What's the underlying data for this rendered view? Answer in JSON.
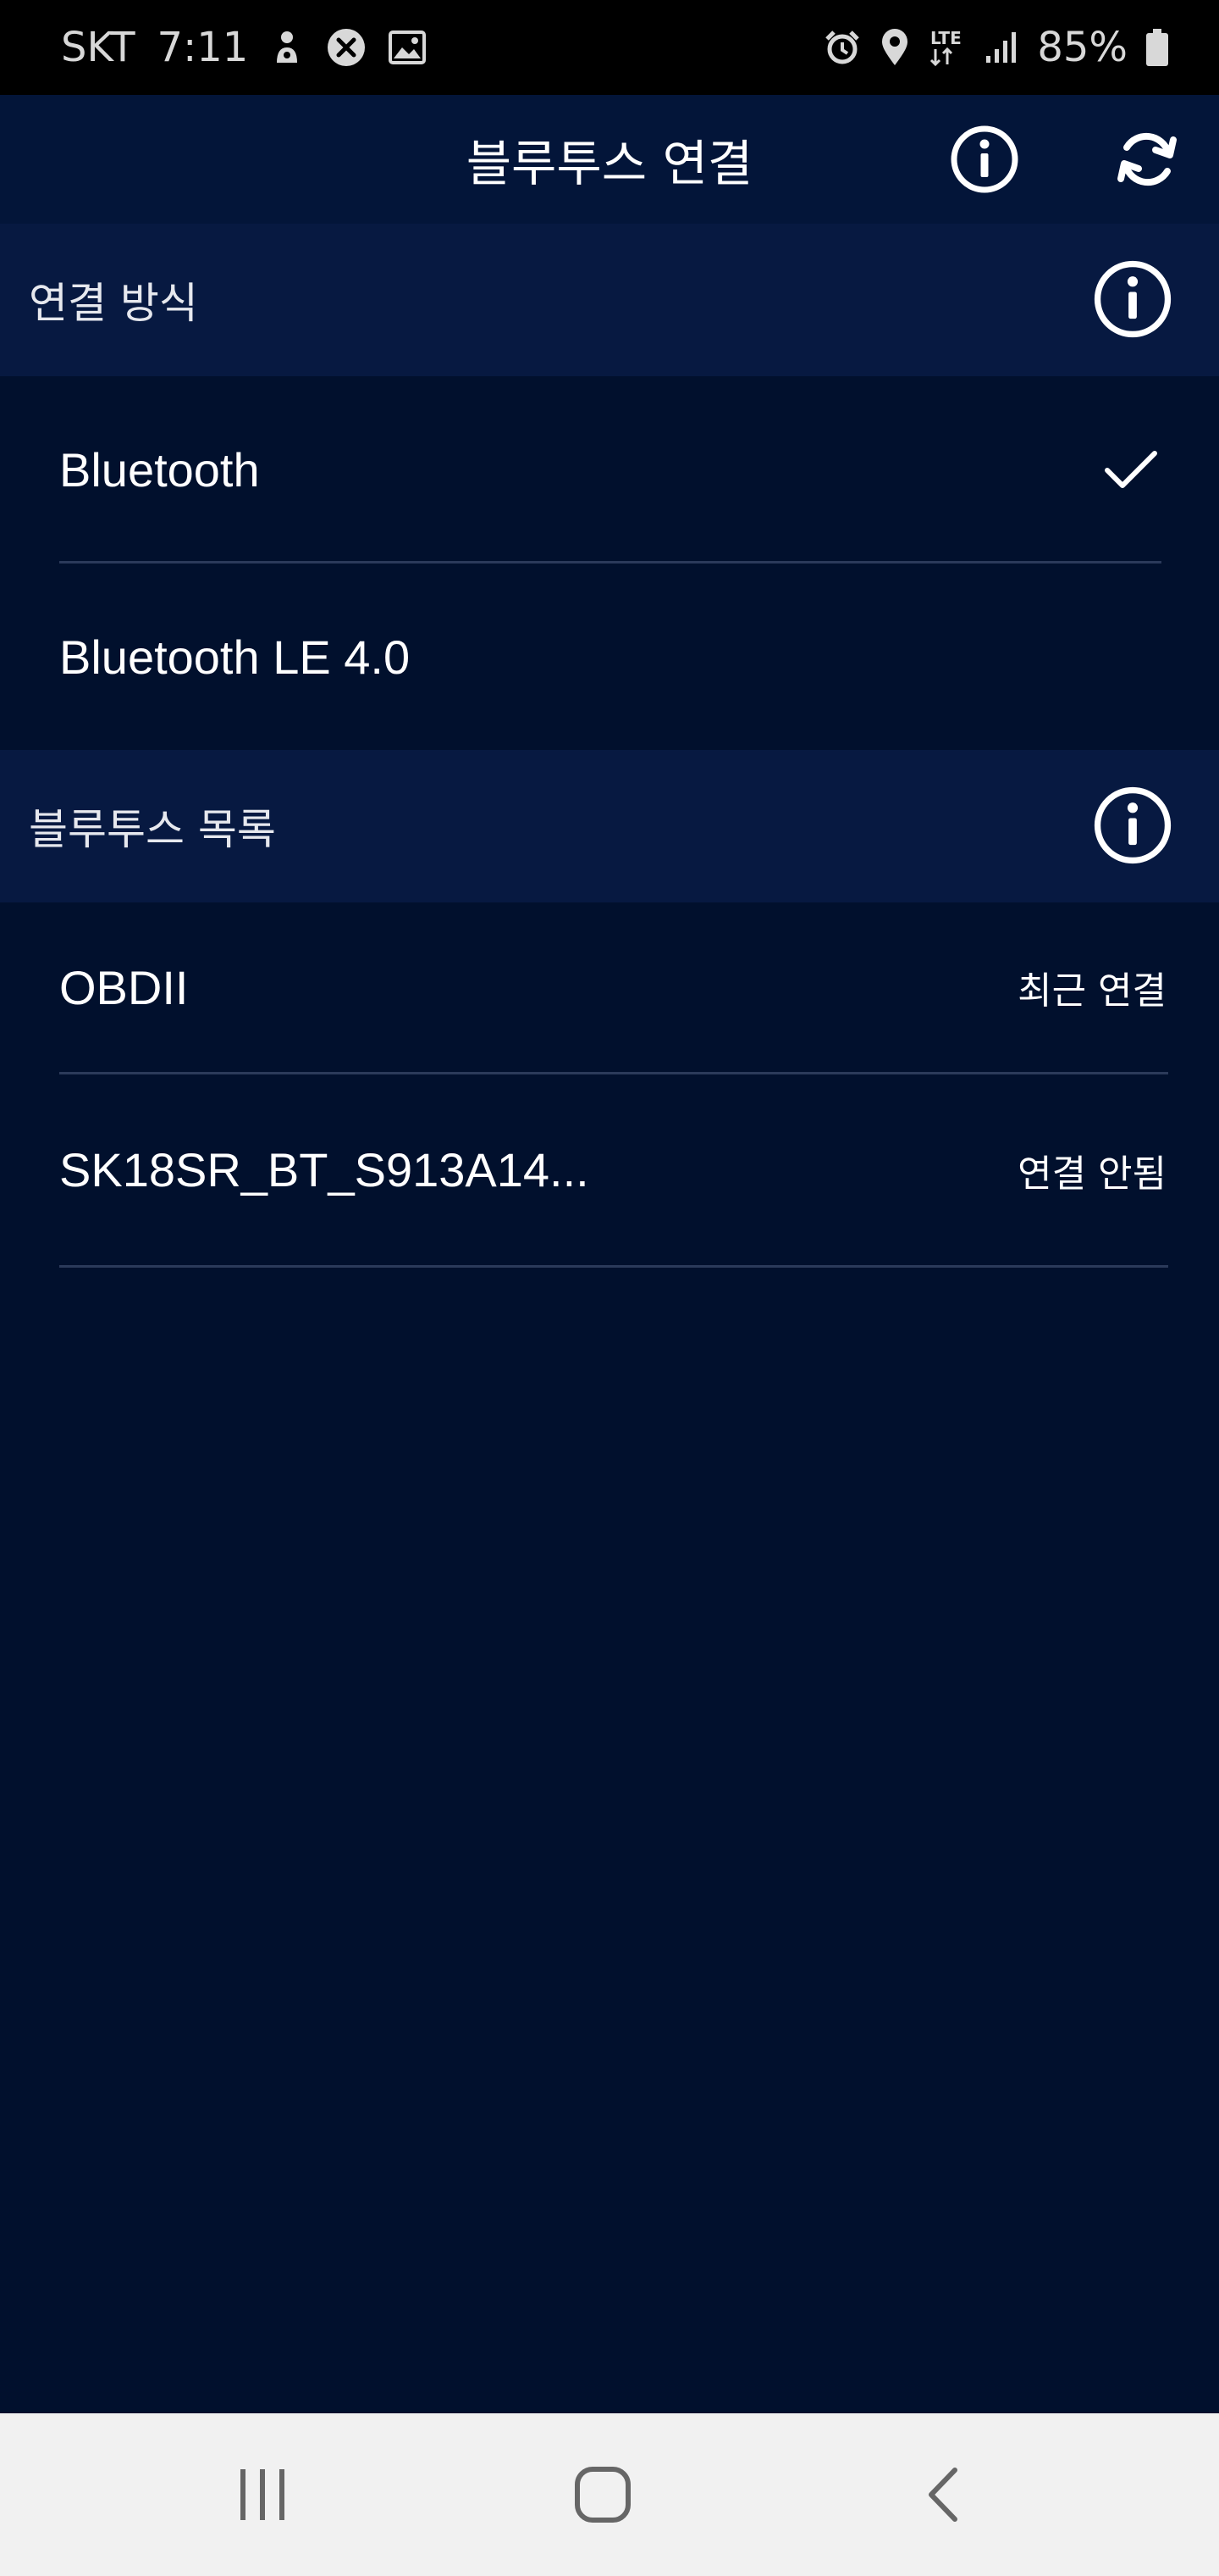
{
  "status_bar": {
    "carrier": "SKT",
    "time": "7:11",
    "network": "LTE",
    "battery": "85%",
    "left_icons": [
      "alarm-clock-notification-icon",
      "blocked-icon",
      "image-icon"
    ],
    "right_icons": [
      "alarm-icon",
      "location-icon",
      "lte-icon",
      "signal-icon",
      "battery-icon"
    ]
  },
  "app_bar": {
    "title": "블루투스 연결",
    "actions": [
      "info-icon",
      "refresh-icon"
    ]
  },
  "connection_method": {
    "header": "연결 방식",
    "options": [
      {
        "label": "Bluetooth",
        "selected": true
      },
      {
        "label": "Bluetooth LE 4.0",
        "selected": false
      }
    ]
  },
  "device_list": {
    "header": "블루투스 목록",
    "devices": [
      {
        "name": "OBDII",
        "status": "최근 연결"
      },
      {
        "name": "SK18SR_BT_S913A14...",
        "status": "연결 안됨"
      }
    ]
  },
  "nav_bar": {
    "buttons": [
      "recent-apps-icon",
      "home-icon",
      "back-icon"
    ]
  },
  "colors": {
    "background": "#01102d",
    "app_bar": "#031539",
    "section_header": "#071941",
    "divider": "#2b3a5a",
    "nav_bar": "#f1f1f1"
  }
}
